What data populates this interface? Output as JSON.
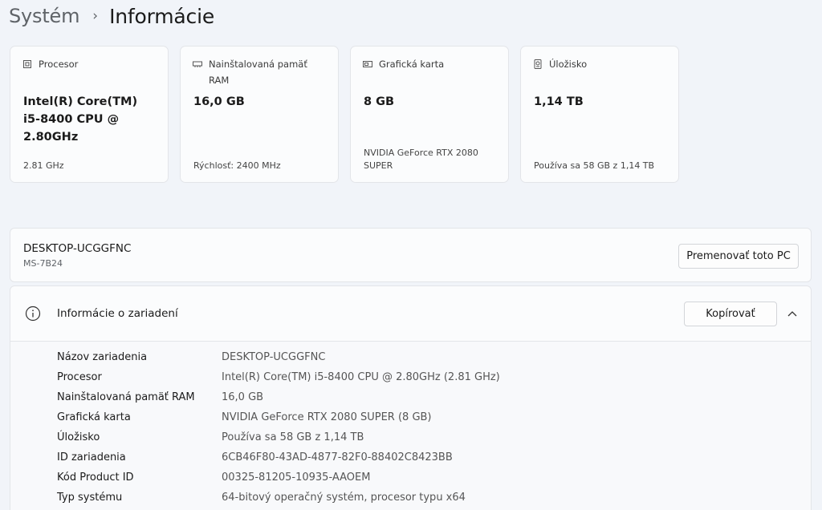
{
  "breadcrumb": {
    "parent": "Systém",
    "separator": "›",
    "current": "Informácie"
  },
  "cards": [
    {
      "icon": "processor-icon",
      "title": "Procesor",
      "value": "Intel(R) Core(TM) i5-8400 CPU @ 2.80GHz",
      "sub": "2.81 GHz"
    },
    {
      "icon": "ram-icon",
      "title": "Nainštalovaná pamäť RAM",
      "value": "16,0 GB",
      "sub": "Rýchlosť: 2400 MHz"
    },
    {
      "icon": "graphics-card-icon",
      "title": "Grafická karta",
      "value": "8 GB",
      "sub": "NVIDIA GeForce RTX 2080 SUPER"
    },
    {
      "icon": "storage-icon",
      "title": "Úložisko",
      "value": "1,14 TB",
      "sub": "Používa sa 58 GB z 1,14 TB"
    }
  ],
  "device": {
    "name": "DESKTOP-UCGGFNC",
    "model": "MS-7B24",
    "rename_label": "Premenovať toto PC"
  },
  "info": {
    "icon": "info-icon",
    "title": "Informácie o zariadení",
    "copy_label": "Kopírovať",
    "rows": [
      {
        "label": "Názov zariadenia",
        "value": "DESKTOP-UCGGFNC"
      },
      {
        "label": "Procesor",
        "value": "Intel(R) Core(TM) i5-8400 CPU @ 2.80GHz (2.81 GHz)"
      },
      {
        "label": "Nainštalovaná pamäť RAM",
        "value": "16,0 GB"
      },
      {
        "label": "Grafická karta",
        "value": "NVIDIA GeForce RTX 2080 SUPER (8 GB)"
      },
      {
        "label": "Úložisko",
        "value": "Používa sa 58 GB z 1,14 TB"
      },
      {
        "label": "ID zariadenia",
        "value": "6CB46F80-43AD-4877-82F0-88402C8423BB"
      },
      {
        "label": "Kód Product ID",
        "value": "00325-81205-10935-AAOEM"
      },
      {
        "label": "Typ systému",
        "value": "64-bitový operačný systém, procesor typu x64"
      }
    ]
  }
}
